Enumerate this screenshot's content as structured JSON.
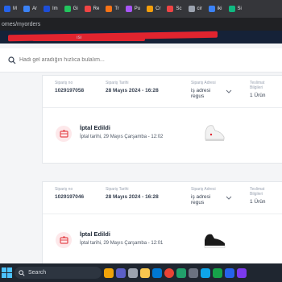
{
  "bookmarks": [
    {
      "label": "M",
      "color": "#2563eb"
    },
    {
      "label": "Ar",
      "color": "#3b82f6"
    },
    {
      "label": "Im",
      "color": "#1d4ed8"
    },
    {
      "label": "Gi",
      "color": "#22c55e"
    },
    {
      "label": "Re",
      "color": "#ef4444"
    },
    {
      "label": "Tr",
      "color": "#f97316"
    },
    {
      "label": "Pu",
      "color": "#a855f7"
    },
    {
      "label": "Cr",
      "color": "#f59e0b"
    },
    {
      "label": "Sc",
      "color": "#ef4444"
    },
    {
      "label": "cir",
      "color": "#9ca3af"
    },
    {
      "label": "iki",
      "color": "#3b82f6"
    },
    {
      "label": "Si",
      "color": "#10b981"
    }
  ],
  "address": {
    "url": "omes/myorders"
  },
  "header": {
    "mark": "ısı"
  },
  "search": {
    "placeholder": "Hadi gel aradığın hızlıca bulalım..."
  },
  "orders": [
    {
      "order_no_label": "Sipariş no",
      "order_no": "1029197058",
      "date_label": "Sipariş Tarihi",
      "date": "28 Mayıs 2024 - 16:28",
      "address_label": "Sipariş Adresi",
      "address": "iş adresi regus",
      "delivery_label": "Teslimat Bilgileri",
      "delivery": "1 Ürün",
      "status_title": "İptal Edildi",
      "status_sub": "İptal tarihi, 29 Mayıs Çarşamba - 12:02",
      "product_color": "#f2f2f2"
    },
    {
      "order_no_label": "Sipariş no",
      "order_no": "1029197046",
      "date_label": "Sipariş Tarihi",
      "date": "28 Mayıs 2024 - 16:28",
      "address_label": "Sipariş Adresi",
      "address": "iş adresi regus",
      "delivery_label": "Teslimat Bilgileri",
      "delivery": "1 Ürün",
      "status_title": "İptal Edildi",
      "status_sub": "İptal tarihi, 29 Mayıs Çarşamba - 12:01",
      "product_color": "#1a1a1a"
    }
  ],
  "taskbar": {
    "search_label": "Search"
  },
  "colors": {
    "accent": "#e0242f",
    "brand_navy": "#152238",
    "status_red": "#e5484d"
  }
}
